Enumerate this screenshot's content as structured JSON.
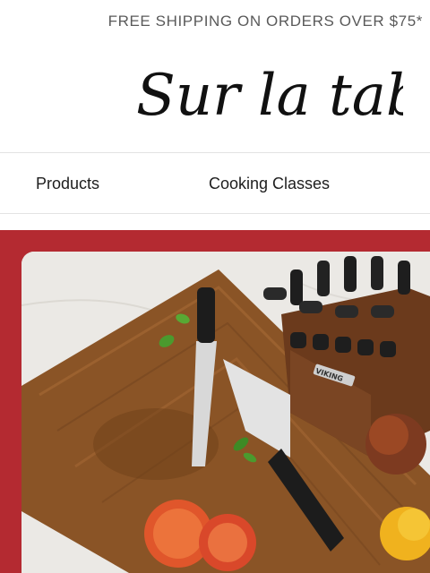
{
  "promo": {
    "text": "FREE SHIPPING ON ORDERS OVER $75*"
  },
  "brand": {
    "logo_text": "Sur la table"
  },
  "nav": {
    "items": [
      {
        "label": "Products"
      },
      {
        "label": "Cooking Classes"
      }
    ]
  },
  "hero": {
    "block_brand_text": "VIKING"
  },
  "colors": {
    "accent": "#b42a31",
    "text": "#1e1e1e",
    "muted": "#5a5a5a"
  }
}
